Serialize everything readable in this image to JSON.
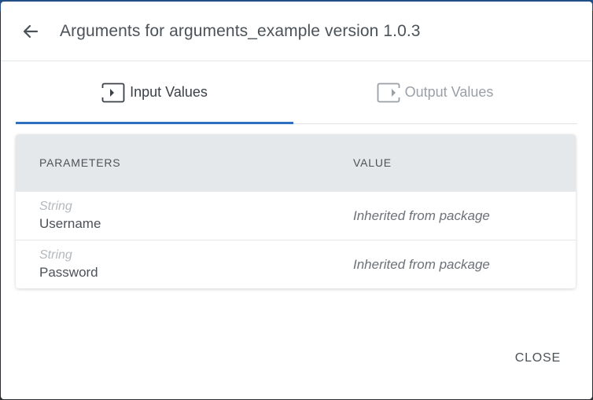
{
  "dialog": {
    "title": "Arguments for arguments_example version 1.0.3",
    "close_label": "CLOSE"
  },
  "tabs": [
    {
      "label": "Input Values",
      "active": true,
      "icon": "input-arrow-icon"
    },
    {
      "label": "Output Values",
      "active": false,
      "icon": "output-arrow-icon"
    }
  ],
  "table": {
    "headers": {
      "parameters": "PARAMETERS",
      "value": "VALUE"
    },
    "rows": [
      {
        "type": "String",
        "name": "Username",
        "value": "Inherited from package"
      },
      {
        "type": "String",
        "name": "Password",
        "value": "Inherited from package"
      }
    ]
  },
  "colors": {
    "accent": "#2f70c0",
    "header_bg": "#e5e8eb",
    "text": "#4b5258"
  }
}
